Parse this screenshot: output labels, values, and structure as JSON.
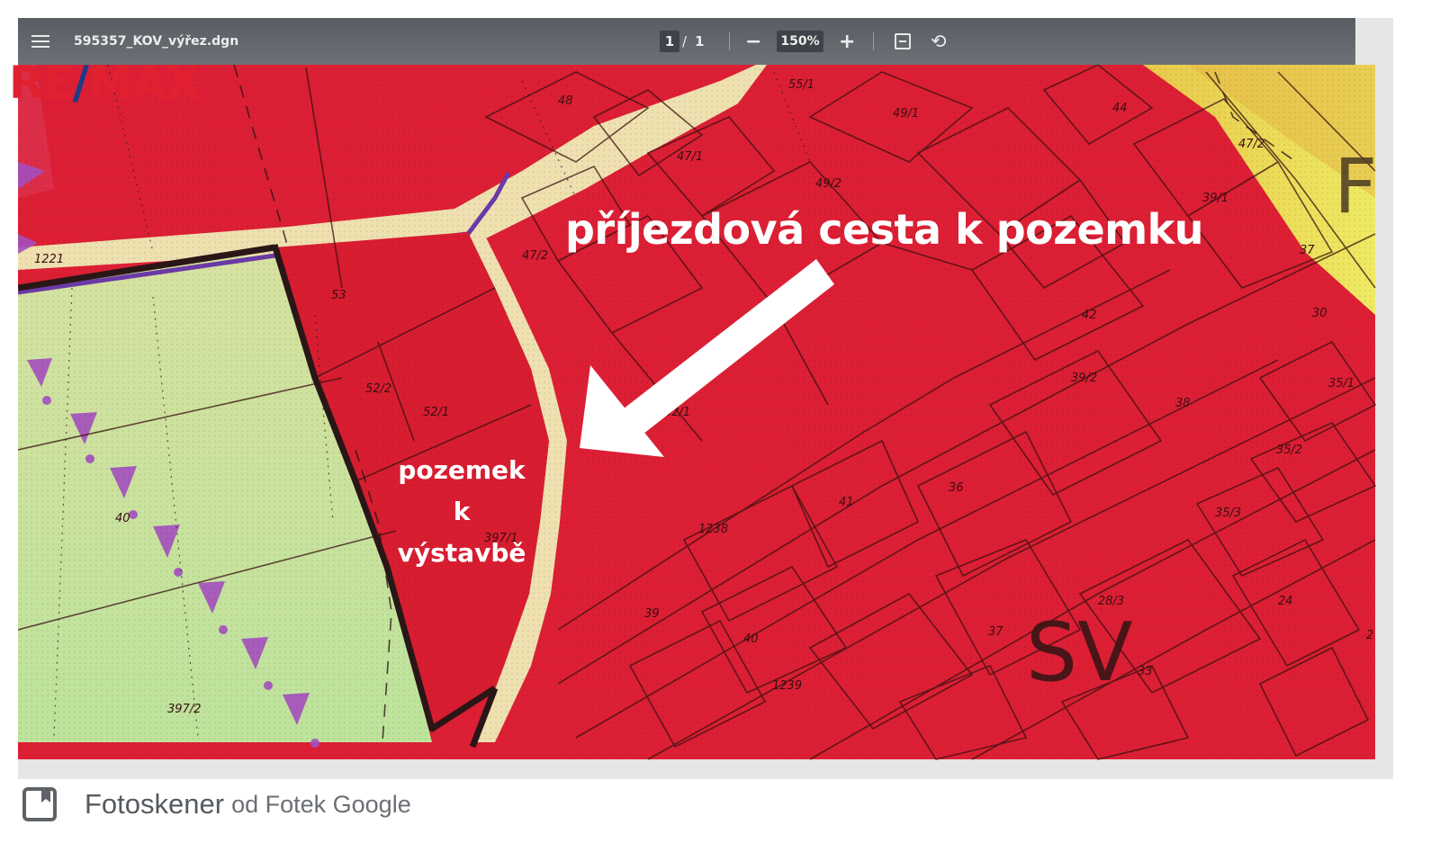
{
  "viewer": {
    "file_name": "595357_KOV_výřez.dgn",
    "page_current": "1",
    "page_sep": "/",
    "page_total": "1",
    "zoom_out_symbol": "−",
    "zoom_level": "150%",
    "zoom_in_symbol": "+",
    "icons": [
      "menu-icon",
      "fit-page-icon",
      "rotate-icon"
    ]
  },
  "logo": {
    "part1": "RE",
    "slash": "/",
    "part2": "MAX"
  },
  "callouts": {
    "road": "příjezdová cesta k pozemku",
    "plot_lines": [
      "pozemek",
      "k",
      "výstavbě"
    ]
  },
  "map": {
    "zone_code": "SV",
    "edge_letter": "F",
    "parcels": [
      "55/1",
      "49/1",
      "48",
      "47/1",
      "49/2",
      "44",
      "47/2",
      "39/1",
      "37",
      "1221",
      "53",
      "42",
      "30",
      "52/2",
      "52/1",
      "42/1",
      "39/2",
      "38",
      "35/1",
      "35/2",
      "36",
      "41",
      "35/3",
      "1238",
      "40/1",
      "397/1",
      "39",
      "40",
      "37",
      "28/3",
      "24",
      "33",
      "1239",
      "397/2",
      "2"
    ],
    "colors": {
      "built_zone": "#dc1f34",
      "green_zone": "#bfe09a",
      "road": "#f0e2ad",
      "yellow_zone": "#e3dd55",
      "route_marker": "#a44fbf",
      "boundary": "#2b1b1b"
    }
  },
  "footer": {
    "app_name": "Fotoskener",
    "app_suffix": "od Fotek Google",
    "icon": "photoscan-icon"
  }
}
